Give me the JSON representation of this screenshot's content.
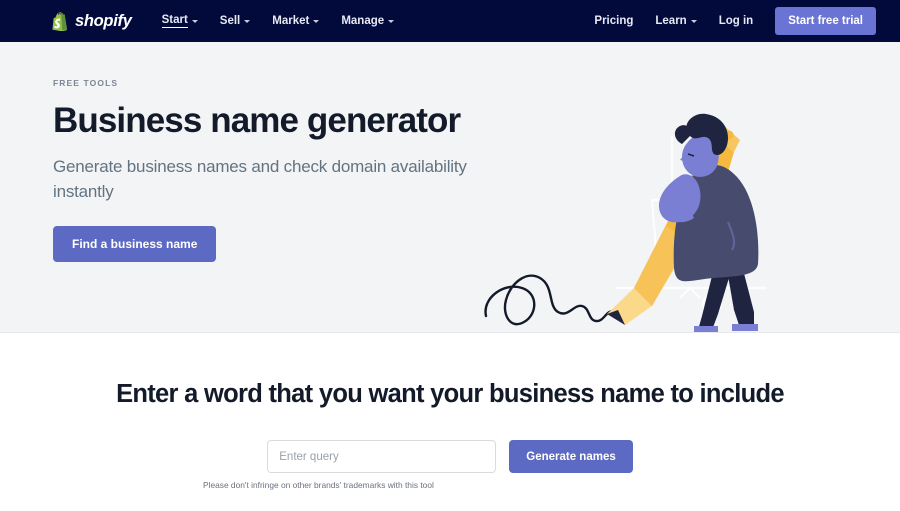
{
  "navbar": {
    "brand": {
      "name": "shopify",
      "icon": "shopify-bag-icon"
    },
    "left_items": [
      {
        "label": "Start",
        "has_chevron": true,
        "active": true
      },
      {
        "label": "Sell",
        "has_chevron": true,
        "active": false
      },
      {
        "label": "Market",
        "has_chevron": true,
        "active": false
      },
      {
        "label": "Manage",
        "has_chevron": true,
        "active": false
      }
    ],
    "right_items": [
      {
        "label": "Pricing",
        "has_chevron": false
      },
      {
        "label": "Learn",
        "has_chevron": true
      },
      {
        "label": "Log in",
        "has_chevron": false
      }
    ],
    "cta_label": "Start free trial",
    "background_color": "#020a3c",
    "cta_color": "#6a74d4"
  },
  "hero": {
    "eyebrow": "FREE TOOLS",
    "title": "Business name generator",
    "subtitle": "Generate business names and check domain availability instantly",
    "cta_label": "Find a business name",
    "cta_color": "#5c6ac4",
    "background_color": "#f3f4f6",
    "illustration": {
      "name": "person-with-giant-pencil-illustration",
      "pencil_color": "#f5b93f",
      "coat_color": "#474c6e",
      "skin_color": "#7b7fd4",
      "hair_color": "#1a1f47",
      "shoe_color": "#7b7fd4",
      "line_color": "#131a29"
    }
  },
  "search": {
    "title": "Enter a word that you want your business name to include",
    "input_value": "",
    "input_placeholder": "Enter query",
    "button_label": "Generate names",
    "button_color": "#5c6ac4",
    "disclaimer": "Please don't infringe on other brands' trademarks with this tool"
  }
}
